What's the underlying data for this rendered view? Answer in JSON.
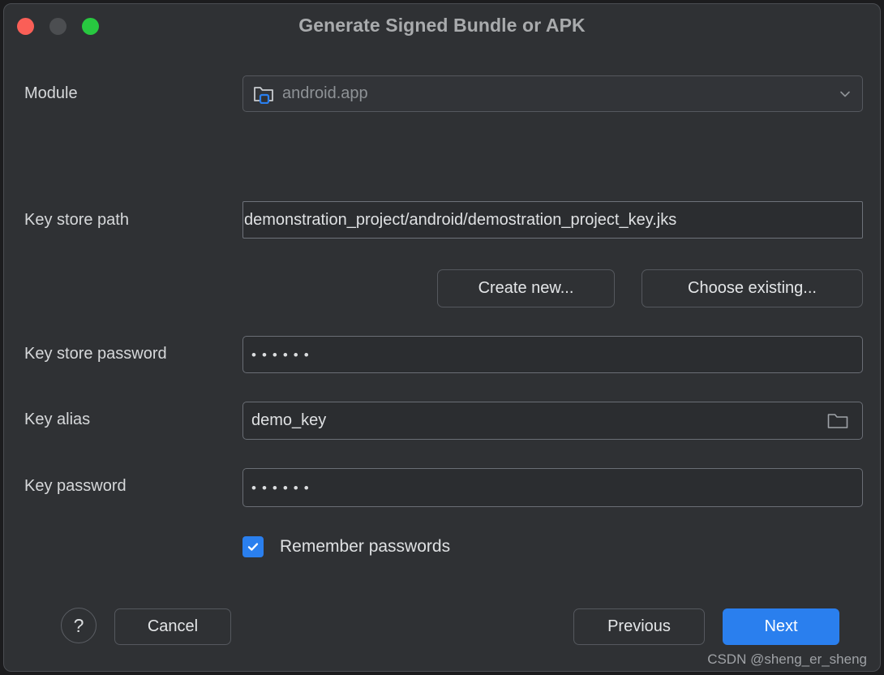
{
  "window": {
    "title": "Generate Signed Bundle or APK",
    "traffic_lights": [
      {
        "name": "close",
        "color": "#fa5f57"
      },
      {
        "name": "minimize",
        "color": "#4c4e51"
      },
      {
        "name": "zoom",
        "color": "#28c840"
      }
    ]
  },
  "form": {
    "module": {
      "label": "Module",
      "value": "android.app",
      "icon": "folder-module-icon",
      "chevron": "chevron-down-icon"
    },
    "key_store_path": {
      "label": "Key store path",
      "value": "demonstration_project/android/demostration_project_key.jks"
    },
    "create_new_label": "Create new...",
    "choose_existing_label": "Choose existing...",
    "key_store_password": {
      "label": "Key store password",
      "value": "••••••"
    },
    "key_alias": {
      "label": "Key alias",
      "value": "demo_key",
      "icon": "folder-icon"
    },
    "key_password": {
      "label": "Key password",
      "value": "••••••"
    },
    "remember_passwords": {
      "label": "Remember passwords",
      "checked": true
    }
  },
  "footer": {
    "help_label": "?",
    "cancel_label": "Cancel",
    "previous_label": "Previous",
    "next_label": "Next"
  },
  "watermark": "CSDN @sheng_er_sheng",
  "colors": {
    "accent": "#2a7fee",
    "window_bg": "#2f3134",
    "field_bg": "#2b2d30",
    "text": "#dfe1e3"
  }
}
